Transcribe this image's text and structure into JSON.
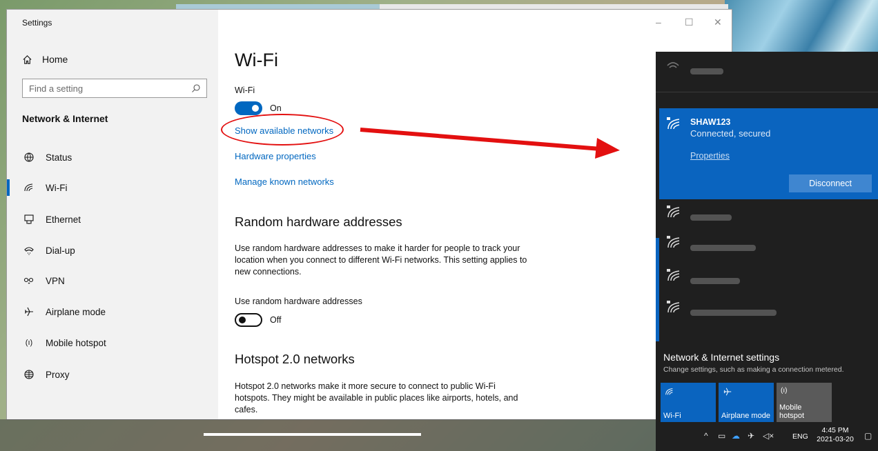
{
  "settings": {
    "window_title": "Settings",
    "home_label": "Home",
    "search_placeholder": "Find a setting",
    "section_title": "Network & Internet",
    "nav": [
      {
        "label": "Status",
        "icon": "globe-status-icon"
      },
      {
        "label": "Wi-Fi",
        "icon": "wifi-icon",
        "active": true
      },
      {
        "label": "Ethernet",
        "icon": "ethernet-icon"
      },
      {
        "label": "Dial-up",
        "icon": "dialup-icon"
      },
      {
        "label": "VPN",
        "icon": "vpn-icon"
      },
      {
        "label": "Airplane mode",
        "icon": "airplane-icon"
      },
      {
        "label": "Mobile hotspot",
        "icon": "hotspot-icon"
      },
      {
        "label": "Proxy",
        "icon": "globe-icon"
      }
    ],
    "caption": {
      "minimize": "–",
      "maximize": "☐",
      "close": "✕"
    },
    "content": {
      "title": "Wi-Fi",
      "wifi_label": "Wi-Fi",
      "wifi_state": "On",
      "links": [
        "Show available networks",
        "Hardware properties",
        "Manage known networks"
      ],
      "random_heading": "Random hardware addresses",
      "random_desc": "Use random hardware addresses to make it harder for people to track your location when you connect to different Wi-Fi networks. This setting applies to new connections.",
      "random_toggle_label": "Use random hardware addresses",
      "random_state": "Off",
      "hotspot_heading": "Hotspot 2.0 networks",
      "hotspot_desc": "Hotspot 2.0 networks make it more secure to connect to public Wi-Fi hotspots. They might be available in public places like airports, hotels, and cafes."
    }
  },
  "flyout": {
    "connected": {
      "name": "SHAW123",
      "status": "Connected, secured",
      "properties": "Properties",
      "disconnect": "Disconnect"
    },
    "settings_title": "Network & Internet settings",
    "settings_desc": "Change settings, such as making a connection metered.",
    "quick_actions": [
      {
        "label": "Wi-Fi",
        "state": "on",
        "icon": "wifi-icon"
      },
      {
        "label": "Airplane mode",
        "state": "on",
        "icon": "airplane-icon"
      },
      {
        "label": "Mobile hotspot",
        "state": "off",
        "icon": "hotspot-icon"
      }
    ]
  },
  "tray": {
    "language": "ENG",
    "time": "4:45 PM",
    "date": "2021-03-20"
  },
  "colors": {
    "accent": "#0067c0",
    "flyout_bg": "#1f1f1f",
    "annotation": "#e31010"
  }
}
